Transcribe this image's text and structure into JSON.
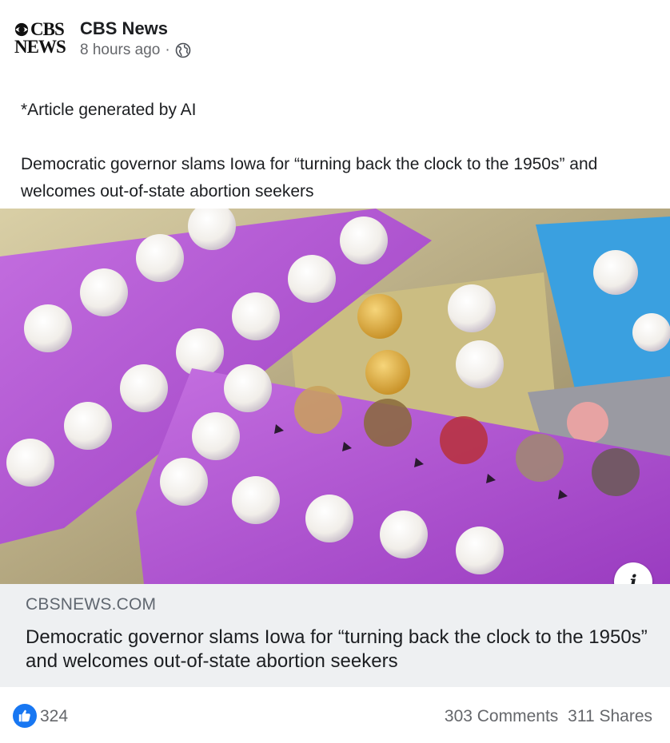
{
  "post": {
    "page_name": "CBS News",
    "logo_line1": "CBS",
    "logo_line2": "NEWS",
    "timestamp": "8 hours ago",
    "separator": "·",
    "audience_icon": "globe-icon",
    "ai_note": "*Article generated by AI",
    "body_text": "Democratic governor slams Iowa for “turning back the clock to the 1950s” and welcomes out-of-state abortion seekers"
  },
  "image": {
    "description_icon": "info-icon",
    "info_glyph": "i"
  },
  "link_card": {
    "domain": "CBSNEWS.COM",
    "title": "Democratic governor slams Iowa for “turning back the clock to the 1950s” and welcomes out-of-state abortion seekers"
  },
  "engagement": {
    "reaction_icon": "like-icon",
    "reaction_count": "324",
    "comments": "303 Comments",
    "shares": "311 Shares"
  },
  "colors": {
    "brand_blue": "#1877f2",
    "card_bg": "#eef0f2",
    "muted_text": "#65676b",
    "pack_purple": "#b35ad0",
    "pack_blue": "#3aa0e0",
    "pack_gold": "#c9b77a"
  }
}
